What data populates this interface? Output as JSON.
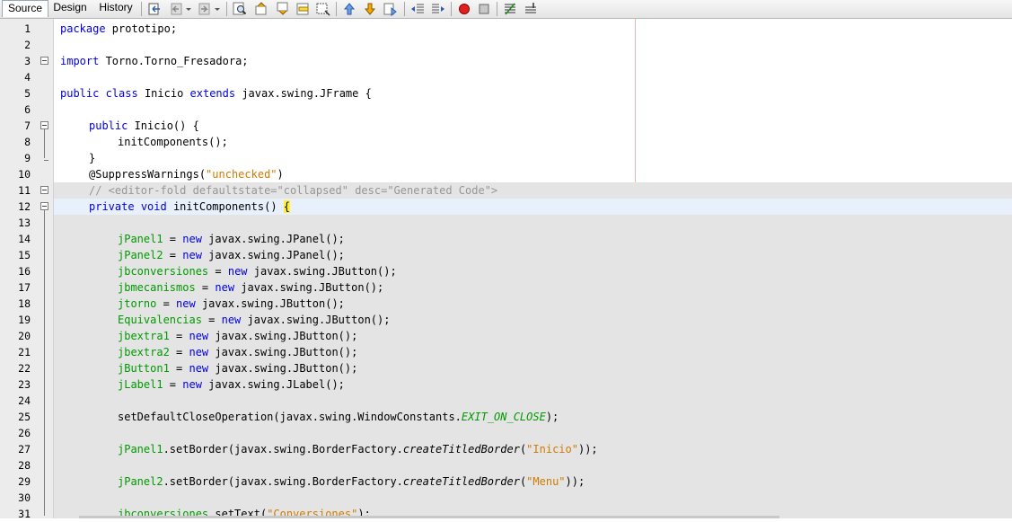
{
  "tabs": [
    "Source",
    "Design",
    "History"
  ],
  "toolbar_icons": [
    "last-edit-icon",
    "back-icon",
    "forward-icon",
    "find-icon",
    "find-previous-icon",
    "find-next-icon",
    "toggle-highlight-icon",
    "find-selection-icon",
    "previous-bookmark-icon",
    "next-bookmark-icon",
    "toggle-bookmark-icon",
    "shift-left-icon",
    "shift-right-icon",
    "start-macro-icon",
    "stop-macro-icon",
    "comment-icon",
    "uncomment-icon"
  ],
  "line_numbers": [
    "1",
    "2",
    "3",
    "4",
    "5",
    "6",
    "7",
    "8",
    "9",
    "10",
    "11",
    "12",
    "13",
    "14",
    "15",
    "16",
    "17",
    "18",
    "19",
    "20",
    "21",
    "22",
    "23",
    "24",
    "25",
    "26",
    "27",
    "28",
    "29",
    "30",
    "31"
  ],
  "code": {
    "l1_kw": "package",
    "l1_rest": " prototipo;",
    "l3_kw": "import",
    "l3_rest": " Torno.Torno_Fresadora;",
    "l5_kw1": "public",
    "l5_kw2": "class",
    "l5_name": " Inicio ",
    "l5_kw3": "extends",
    "l5_rest": " javax.swing.JFrame {",
    "l7_kw": "public",
    "l7_rest": " Inicio() {",
    "l8": "initComponents();",
    "l9": "}",
    "l10_ann": "@SuppressWarnings(",
    "l10_str": "\"unchecked\"",
    "l10_end": ")",
    "l11": "// <editor-fold defaultstate=\"collapsed\" desc=\"Generated Code\">",
    "l12_kw1": "private",
    "l12_kw2": "void",
    "l12_rest": " initComponents() ",
    "l12_brace": "{",
    "l14_f": "jPanel1",
    "l14_m": " = ",
    "l14_kw": "new",
    "l14_r": " javax.swing.JPanel();",
    "l15_f": "jPanel2",
    "l15_m": " = ",
    "l15_kw": "new",
    "l15_r": " javax.swing.JPanel();",
    "l16_f": "jbconversiones",
    "l16_m": " = ",
    "l16_kw": "new",
    "l16_r": " javax.swing.JButton();",
    "l17_f": "jbmecanismos",
    "l17_m": " = ",
    "l17_kw": "new",
    "l17_r": " javax.swing.JButton();",
    "l18_f": "jtorno",
    "l18_m": " = ",
    "l18_kw": "new",
    "l18_r": " javax.swing.JButton();",
    "l19_f": "Equivalencias",
    "l19_m": " = ",
    "l19_kw": "new",
    "l19_r": " javax.swing.JButton();",
    "l20_f": "jbextra1",
    "l20_m": " = ",
    "l20_kw": "new",
    "l20_r": " javax.swing.JButton();",
    "l21_f": "jbextra2",
    "l21_m": " = ",
    "l21_kw": "new",
    "l21_r": " javax.swing.JButton();",
    "l22_f": "jButton1",
    "l22_m": " = ",
    "l22_kw": "new",
    "l22_r": " javax.swing.JButton();",
    "l23_f": "jLabel1",
    "l23_m": " = ",
    "l23_kw": "new",
    "l23_r": " javax.swing.JLabel();",
    "l25_a": "setDefaultCloseOperation(javax.swing.WindowConstants.",
    "l25_c": "EXIT_ON_CLOSE",
    "l25_e": ");",
    "l27_f": "jPanel1",
    "l27_a": ".setBorder(javax.swing.BorderFactory.",
    "l27_m": "createTitledBorder",
    "l27_p": "(",
    "l27_s": "\"Inicio\"",
    "l27_e": "));",
    "l29_f": "jPanel2",
    "l29_a": ".setBorder(javax.swing.BorderFactory.",
    "l29_m": "createTitledBorder",
    "l29_p": "(",
    "l29_s": "\"Menu\"",
    "l29_e": "));",
    "l31_f": "jbconversiones",
    "l31_a": ".setText(",
    "l31_s": "\"Conversiones\"",
    "l31_e": ");"
  }
}
